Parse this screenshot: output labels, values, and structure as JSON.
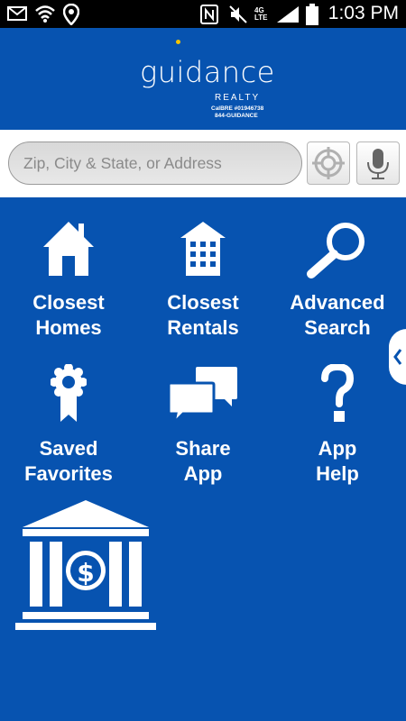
{
  "status_bar": {
    "time": "1:03 PM",
    "network_label": "4G LTE"
  },
  "header": {
    "logo_word": "guidance",
    "logo_sub": "REALTY",
    "license_line1": "CalBRE #01946738",
    "license_line2": "844-GUIDANCE"
  },
  "search": {
    "placeholder": "Zip, City & State, or Address"
  },
  "menu": [
    {
      "line1": "Closest",
      "line2": "Homes",
      "icon": "house-icon"
    },
    {
      "line1": "Closest",
      "line2": "Rentals",
      "icon": "building-icon"
    },
    {
      "line1": "Advanced",
      "line2": "Search",
      "icon": "magnifier-icon"
    },
    {
      "line1": "Saved",
      "line2": "Favorites",
      "icon": "ribbon-icon"
    },
    {
      "line1": "Share",
      "line2": "App",
      "icon": "chat-bubbles-icon"
    },
    {
      "line1": "App",
      "line2": "Help",
      "icon": "question-icon"
    }
  ],
  "colors": {
    "background": "#0753b0",
    "logo_dot": "#f5c400"
  }
}
